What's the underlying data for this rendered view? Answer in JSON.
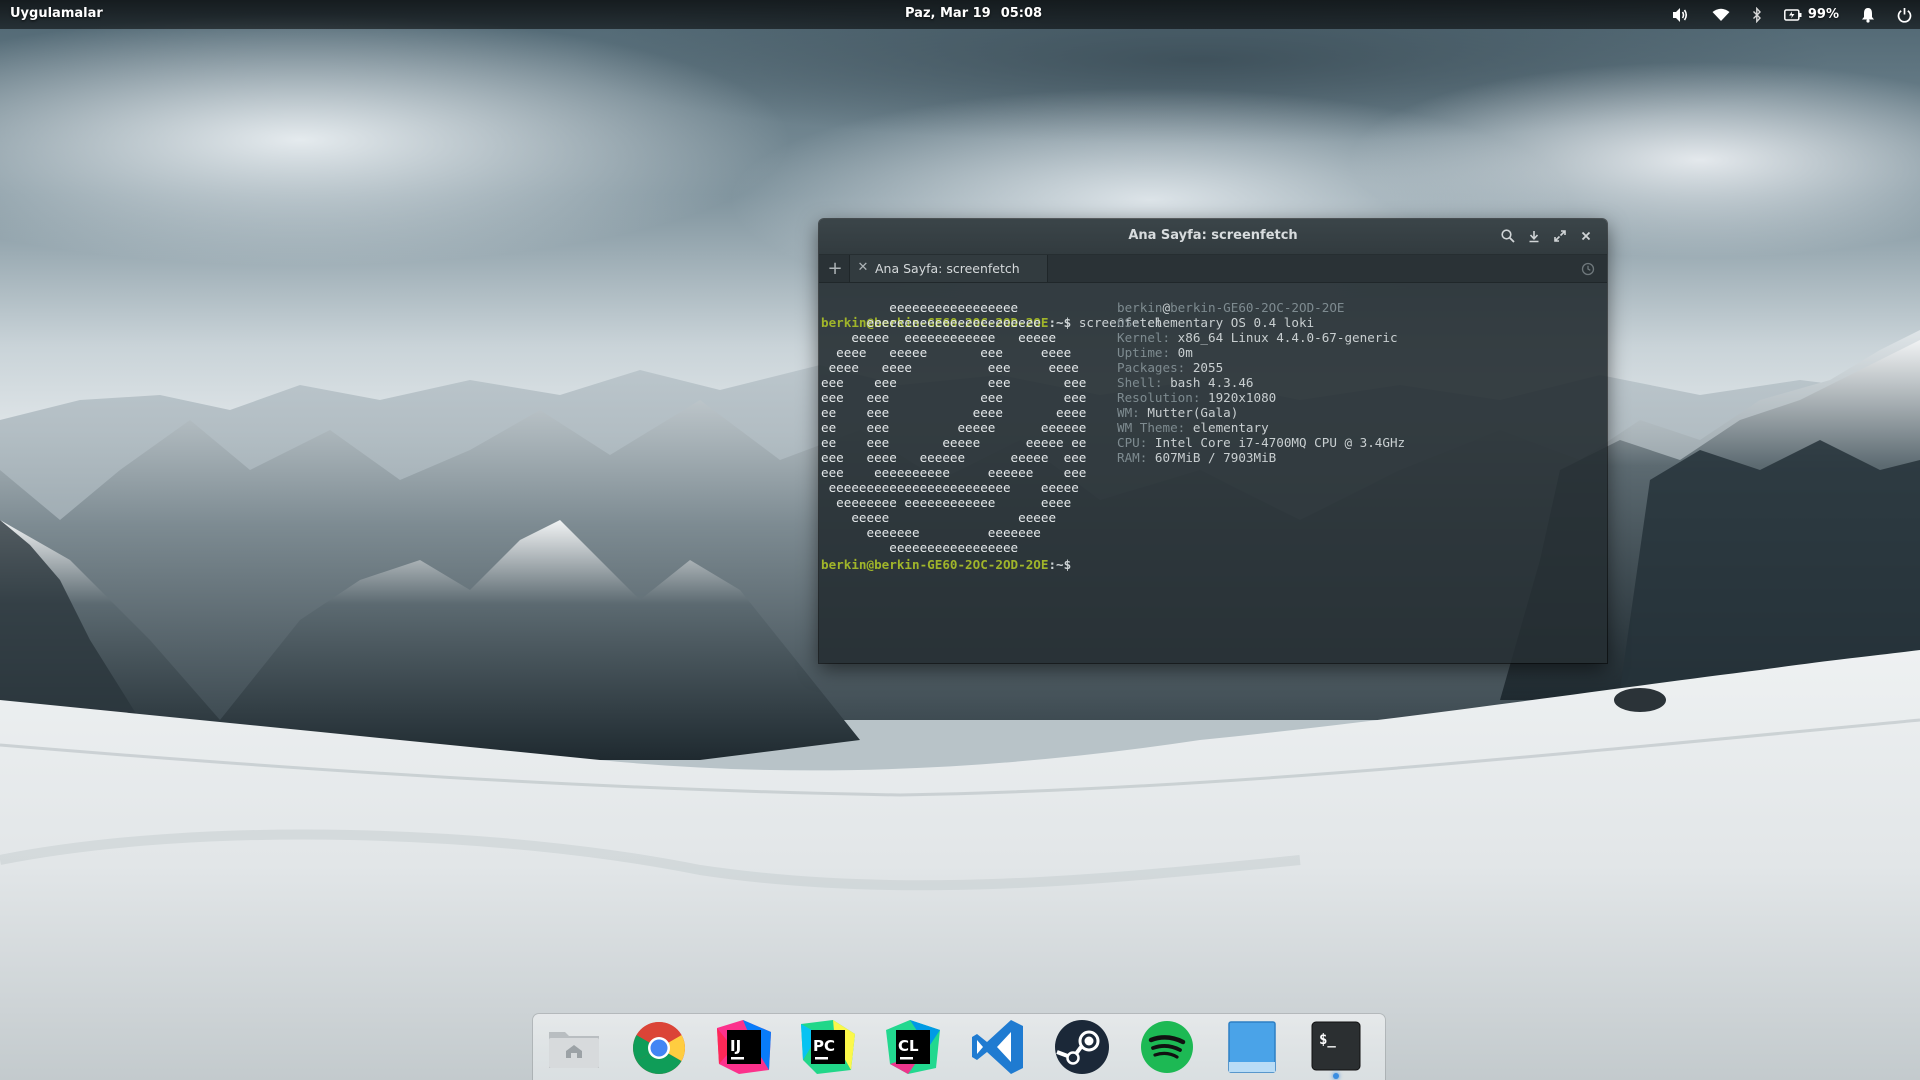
{
  "top_panel": {
    "apps_label": "Uygulamalar",
    "date": "Paz, Mar 19",
    "time": "05:08",
    "battery": "99%",
    "icons": [
      "volume-icon",
      "wifi-icon",
      "bluetooth-icon",
      "battery-icon",
      "notification-icon",
      "power-icon"
    ]
  },
  "terminal": {
    "title": "Ana Sayfa: screenfetch",
    "tab_label": "Ana Sayfa: screenfetch",
    "prompt": "berkin@berkin-GE60-2OC-2OD-2OE",
    "prompt_suffix": ":~$",
    "command": "screenfetch",
    "logo_lines": [
      "         eeeeeeeeeeeeeeeee",
      "      eeeeeeeeeeeeeeeeeeeeeee",
      "    eeeee  eeeeeeeeeeee   eeeee",
      "  eeee   eeeee       eee     eeee",
      " eeee   eeee          eee     eeee",
      "eee    eee            eee       eee",
      "eee   eee            eee        eee",
      "ee    eee           eeee       eeee",
      "ee    eee         eeeee      eeeeee",
      "ee    eee       eeeee      eeeee ee",
      "eee   eeee   eeeeee      eeeee  eee",
      "eee    eeeeeeeeee     eeeeee    eee",
      " eeeeeeeeeeeeeeeeeeeeeeee    eeeee",
      "  eeeeeeee eeeeeeeeeeee      eeee",
      "    eeeee                 eeeee",
      "      eeeeeee         eeeeeee",
      "         eeeeeeeeeeeeeeeee"
    ],
    "info": [
      {
        "key": "berkin",
        "sep": "@",
        "val": "berkin-GE60-2OC-2OD-2OE"
      },
      {
        "key": "OS:",
        "val": " elementary OS 0.4 loki"
      },
      {
        "key": "Kernel:",
        "val": " x86_64 Linux 4.4.0-67-generic"
      },
      {
        "key": "Uptime:",
        "val": " 0m"
      },
      {
        "key": "Packages:",
        "val": " 2055"
      },
      {
        "key": "Shell:",
        "val": " bash 4.3.46"
      },
      {
        "key": "Resolution:",
        "val": " 1920x1080"
      },
      {
        "key": "WM:",
        "val": " Mutter(Gala)"
      },
      {
        "key": "WM Theme:",
        "val": " elementary"
      },
      {
        "key": "CPU:",
        "val": " Intel Core i7-4700MQ CPU @ 3.4GHz"
      },
      {
        "key": "RAM:",
        "val": " 607MiB / 7903MiB"
      }
    ]
  },
  "dock": {
    "items": [
      {
        "name": "files-app",
        "label": "Files"
      },
      {
        "name": "chrome-app",
        "label": "Google Chrome"
      },
      {
        "name": "intellij-app",
        "label": "IntelliJ IDEA",
        "text": "IJ"
      },
      {
        "name": "pycharm-app",
        "label": "PyCharm",
        "text": "PC"
      },
      {
        "name": "clion-app",
        "label": "CLion",
        "text": "CL"
      },
      {
        "name": "vscode-app",
        "label": "Visual Studio Code"
      },
      {
        "name": "steam-app",
        "label": "Steam"
      },
      {
        "name": "spotify-app",
        "label": "Spotify"
      },
      {
        "name": "desktop-app",
        "label": "Show Desktop"
      },
      {
        "name": "terminal-app",
        "label": "Terminal",
        "text": "$_",
        "running": true
      }
    ]
  },
  "colors": {
    "prompt": "#a0b52a",
    "running_indicator": "#3a8de0"
  }
}
